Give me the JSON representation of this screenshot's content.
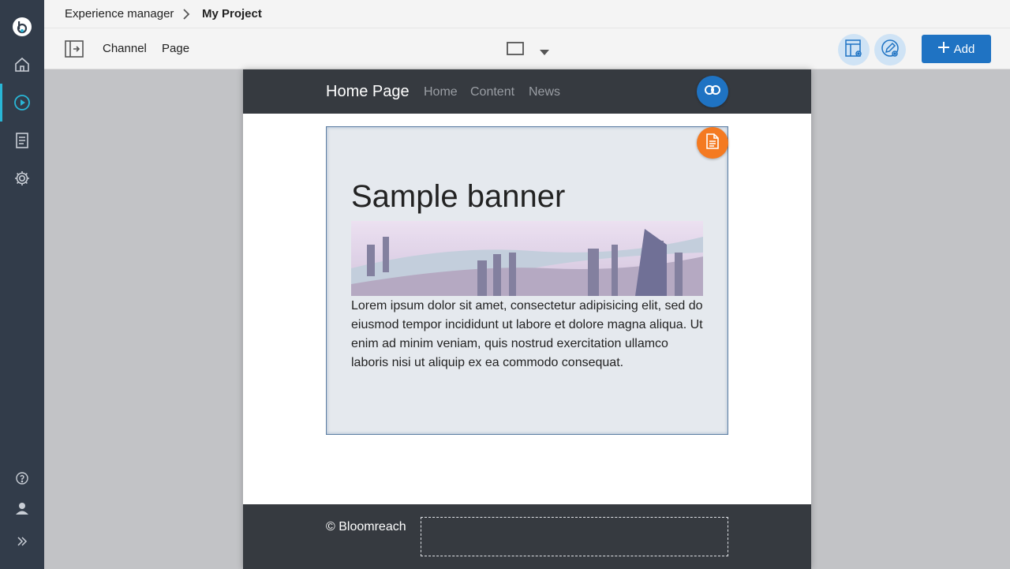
{
  "breadcrumb": {
    "root": "Experience manager",
    "current": "My Project"
  },
  "toolbar": {
    "channel_label": "Channel",
    "page_label": "Page",
    "add_label": "Add"
  },
  "rail": {
    "items": [
      "logo",
      "home-icon",
      "experience-manager-icon",
      "content-icon",
      "settings-icon"
    ],
    "bottom": [
      "help-icon",
      "user-icon",
      "expand-icon"
    ],
    "active": "experience-manager-icon"
  },
  "site": {
    "brand": "Home Page",
    "nav": [
      "Home",
      "Content",
      "News"
    ],
    "banner": {
      "title": "Sample banner",
      "body": "Lorem ipsum dolor sit amet, consectetur adipisicing elit, sed do eiusmod tempor incididunt ut labore et dolore magna aliqua. Ut enim ad minim veniam, quis nostrud exercitation ullamco laboris nisi ut aliquip ex ea commodo consequat."
    },
    "footer": "© Bloomreach"
  },
  "colors": {
    "rail": "#323c4a",
    "accent": "#1f73c3",
    "active_indicator": "#29b6d6",
    "doc_badge": "#f47a21"
  }
}
